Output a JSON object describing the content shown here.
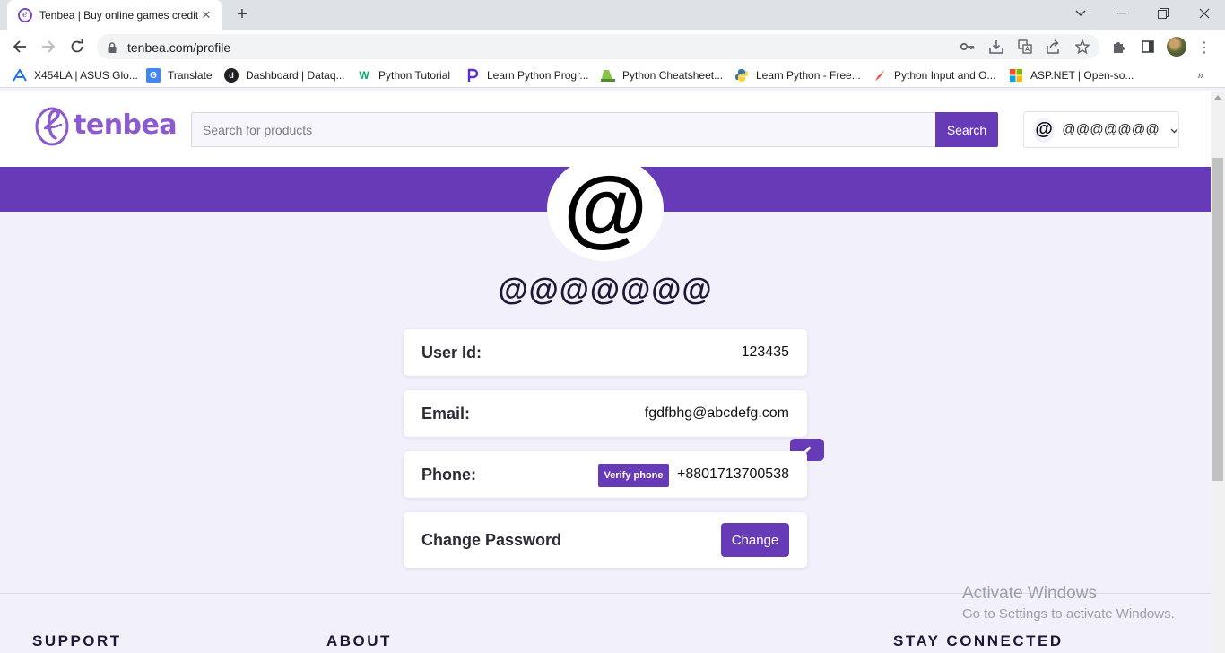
{
  "browser": {
    "tab_title": "Tenbea | Buy online games credit",
    "url": "tenbea.com/profile",
    "bookmarks": [
      {
        "label": "X454LA | ASUS Glo...",
        "icon": "asus-icon"
      },
      {
        "label": "Translate",
        "icon": "google-translate-icon"
      },
      {
        "label": "Dashboard | Dataq...",
        "icon": "dataquest-icon"
      },
      {
        "label": "Python Tutorial",
        "icon": "w3schools-icon"
      },
      {
        "label": "Learn Python Progr...",
        "icon": "programiz-icon"
      },
      {
        "label": "Python Cheatsheet...",
        "icon": "cheatsheet-icon"
      },
      {
        "label": "Learn Python - Free...",
        "icon": "python-icon"
      },
      {
        "label": "Python Input and O...",
        "icon": "swift-icon"
      },
      {
        "label": "ASP.NET | Open-so...",
        "icon": "microsoft-icon"
      }
    ],
    "bookmarks_more": "»"
  },
  "header": {
    "logo_text": "tenbea",
    "search_placeholder": "Search for products",
    "search_label": "Search",
    "user_avatar": "@",
    "user_name": "@@@@@@@"
  },
  "profile": {
    "avatar": "@",
    "name": "@@@@@@@",
    "user_id_label": "User Id:",
    "user_id": "123435",
    "email_label": "Email:",
    "email": "fgdfbhg@abcdefg.com",
    "phone_label": "Phone:",
    "verify_label": "Verify phone",
    "phone": "+8801713700538",
    "password_label": "Change Password",
    "change_label": "Change"
  },
  "footer": {
    "support": "SUPPORT",
    "about": "ABOUT",
    "stay_connected": "STAY CONNECTED"
  },
  "watermark": {
    "title": "Activate Windows",
    "subtitle": "Go to Settings to activate Windows."
  },
  "colors": {
    "brand": "#673ab7",
    "page_bg": "#f1f0fb"
  }
}
